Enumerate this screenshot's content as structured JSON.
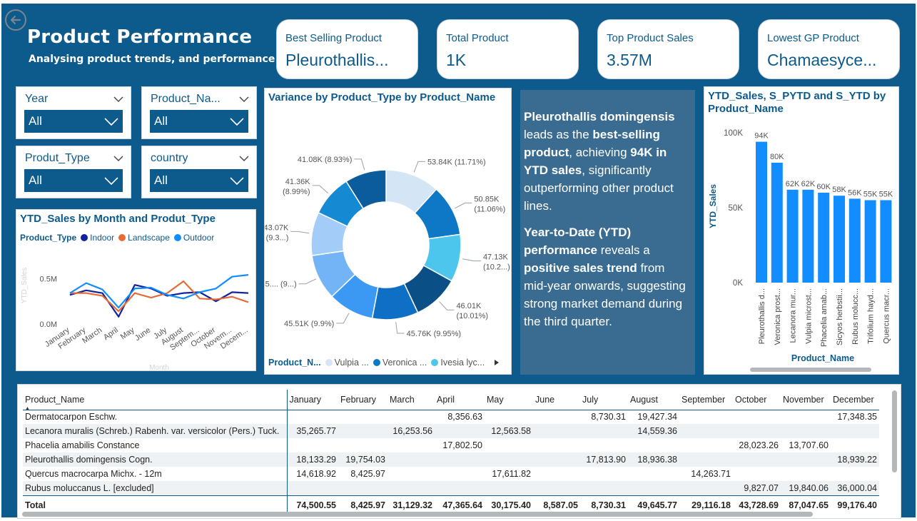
{
  "header": {
    "title": "Product Performance",
    "subtitle": "Analysing product trends, and  performance"
  },
  "kpis": [
    {
      "label": "Best Selling Product",
      "value": "Pleurothallis..."
    },
    {
      "label": "Total Product",
      "value": "1K"
    },
    {
      "label": "Top Product Sales",
      "value": "3.57M"
    },
    {
      "label": "Lowest GP Product",
      "value": "Chamaesyce..."
    }
  ],
  "slicers": [
    {
      "label": "Year",
      "value": "All"
    },
    {
      "label": "Product_Na...",
      "value": "All"
    },
    {
      "label": "Produt_Type",
      "value": "All"
    },
    {
      "label": "country",
      "value": "All"
    }
  ],
  "colors": {
    "dashboard_bg": "#0d5a8c",
    "indoor": "#12239e",
    "landscape": "#e66c37",
    "outdoor": "#118dff",
    "bar": "#118dff",
    "insight_bg": "#3a6b91"
  },
  "icons": {
    "back": "arrow-left-circle-icon",
    "dropdown": "chevron-down-icon"
  },
  "line_chart": {
    "title": "YTD_Sales by Month and Produt_Type",
    "legend_title": "Product_Type",
    "ylabel": "YTD_Sales",
    "xlabel": "Month",
    "y_ticks": [
      "0.5M",
      "0.0M"
    ]
  },
  "donut_chart": {
    "title": "Variance by Product_Type by Product_Name",
    "legend_title": "Product_N...",
    "legend_items": [
      "Vulpia ...",
      "Veronica ...",
      "Ivesia lyc..."
    ],
    "labels": [
      {
        "value": "53.84K (11.71%)"
      },
      {
        "value": "50.85K",
        "pct": "(11.06%)"
      },
      {
        "value": "47.13K",
        "pct": "(10.2...)"
      },
      {
        "value": "46.01K",
        "pct": "(10.01%)"
      },
      {
        "value": "45.76K (9.95%)"
      },
      {
        "value": "45.51K (9.9%)"
      },
      {
        "value": "45.... (9...)"
      },
      {
        "value": "43.07K",
        "pct": "(9.3...)"
      },
      {
        "value": "41.36K",
        "pct": "(8.99%)"
      },
      {
        "value": "41.08K (8.93%)"
      }
    ]
  },
  "insight": {
    "p1": {
      "a": "Pleurothallis domingensis",
      "b": " leads as the ",
      "c": "best-selling product",
      "d": ", achieving ",
      "e": "94K in YTD sales",
      "f": ", significantly outperforming other product lines."
    },
    "p2": {
      "a": "Year-to-Date (YTD) performance",
      "b": " reveals a ",
      "c": "positive sales trend",
      "d": " from mid-year onwards, suggesting strong market demand during the third quarter."
    }
  },
  "bar_chart": {
    "title_line1": "YTD_Sales, S_PYTD and S_YTD by",
    "title_line2": "Product_Name",
    "ylabel": "YTD_Sales",
    "xlabel": "Product_Name",
    "y_ticks": [
      "100K",
      "50K",
      "0K"
    ]
  },
  "chart_data": [
    {
      "type": "line",
      "title": "YTD_Sales by Month and Produt_Type",
      "xlabel": "Month",
      "ylabel": "YTD_Sales",
      "x": [
        "January",
        "February",
        "March",
        "April",
        "May",
        "June",
        "July",
        "August",
        "Septem...",
        "October",
        "Novem...",
        "Decem..."
      ],
      "ylim": [
        0,
        0.8
      ],
      "series": [
        {
          "name": "Indoor",
          "values": [
            0.32,
            0.37,
            0.34,
            0.08,
            0.43,
            0.39,
            0.31,
            0.34,
            0.35,
            0.25,
            0.35,
            0.34
          ]
        },
        {
          "name": "Landscape",
          "values": [
            0.34,
            0.34,
            0.31,
            0.14,
            0.34,
            0.29,
            0.34,
            0.47,
            0.28,
            0.27,
            0.3,
            0.24
          ]
        },
        {
          "name": "Outdoor",
          "values": [
            0.34,
            0.45,
            0.38,
            0.18,
            0.39,
            0.4,
            0.32,
            0.28,
            0.35,
            0.39,
            0.52,
            0.54
          ]
        }
      ],
      "legend": "top-left"
    },
    {
      "type": "pie",
      "title": "Variance by Product_Type by Product_Name",
      "legend_title": "Product_N...",
      "values": [
        53.84,
        50.85,
        47.13,
        46.01,
        45.76,
        45.51,
        45.2,
        43.07,
        41.36,
        41.08
      ],
      "percents": [
        11.71,
        11.06,
        10.25,
        10.01,
        9.95,
        9.9,
        9.83,
        9.37,
        8.99,
        8.93
      ]
    },
    {
      "type": "bar",
      "title": "YTD_Sales, S_PYTD and S_YTD by Product_Name",
      "xlabel": "Product_Name",
      "ylabel": "YTD_Sales",
      "categories": [
        "Pleurothallis d...",
        "Veronica prost...",
        "Lecanora mur...",
        "Vulpia microst...",
        "Phacelia amab...",
        "Sicyos herbstii...",
        "Rubus molucc...",
        "Trifolium hayd...",
        "Quercus macr..."
      ],
      "values": [
        94,
        80,
        62,
        62,
        60,
        58,
        56,
        55,
        55
      ],
      "data_labels": [
        "94K",
        "80K",
        "62K",
        "62K",
        "60K",
        "58K",
        "56K",
        "55K",
        "55K"
      ],
      "ylim": [
        0,
        100
      ]
    }
  ],
  "table": {
    "columns": [
      "Product_Name",
      "January",
      "February",
      "March",
      "April",
      "May",
      "June",
      "July",
      "August",
      "September",
      "October",
      "November",
      "December"
    ],
    "rows": [
      [
        "Dermatocarpon Eschw.",
        "",
        "",
        "",
        "8,356.63",
        "",
        "",
        "8,730.31",
        "19,427.34",
        "",
        "",
        "",
        "17,348.35"
      ],
      [
        "Lecanora muralis (Schreb.) Rabenh. var. versicolor (Pers.) Tuck.",
        "35,265.77",
        "",
        "16,253.56",
        "",
        "12,563.58",
        "",
        "",
        "14,559.36",
        "",
        "",
        "",
        ""
      ],
      [
        "Phacelia amabilis Constance",
        "",
        "",
        "",
        "17,802.50",
        "",
        "",
        "",
        "",
        "",
        "28,023.26",
        "13,707.60",
        ""
      ],
      [
        "Pleurothallis domingensis Cogn.",
        "18,133.29",
        "19,754.03",
        "",
        "",
        "",
        "",
        "17,813.90",
        "18,936.38",
        "",
        "",
        "",
        "18,939.22"
      ],
      [
        "Quercus macrocarpa Michx. - 12m",
        "14,618.92",
        "8,425.97",
        "",
        "",
        "17,611.82",
        "",
        "",
        "",
        "14,263.71",
        "",
        "",
        ""
      ],
      [
        "Rubus moluccanus L. [excluded]",
        "",
        "",
        "",
        "",
        "",
        "",
        "",
        "",
        "",
        "9,827.07",
        "19,840.06",
        "36,000.04"
      ]
    ],
    "total": [
      "Total",
      "74,500.55",
      "8,425.97",
      "31,129.32",
      "47,365.64",
      "30,175.40",
      "8,587.05",
      "8,730.31",
      "49,645.77",
      "29,116.18",
      "43,728.69",
      "87,047.65",
      "99,176.40"
    ]
  }
}
